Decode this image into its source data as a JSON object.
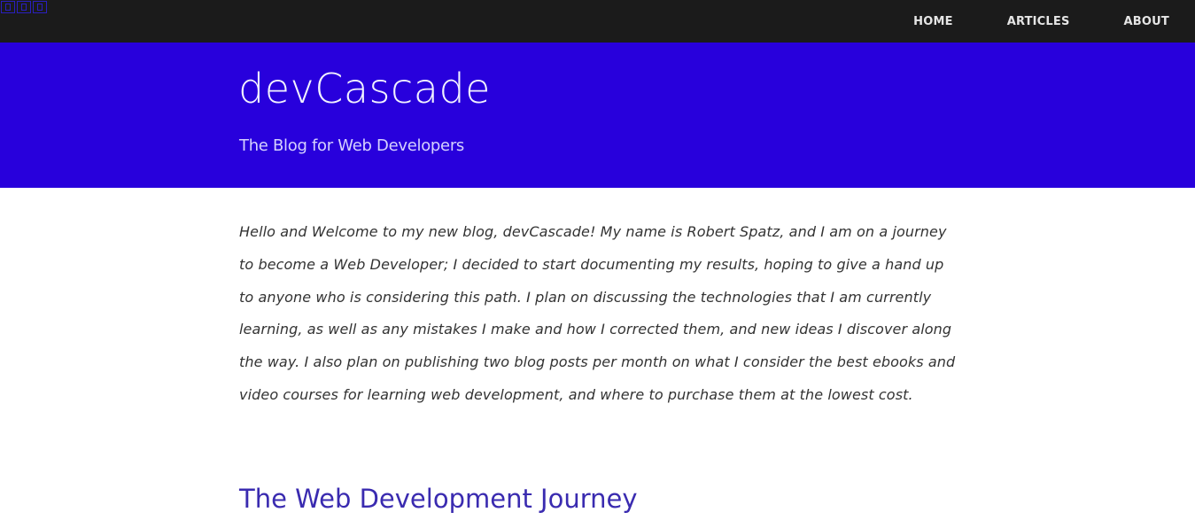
{
  "social_icons": [
    "square-icon",
    "square-icon",
    "square-icon"
  ],
  "nav": {
    "items": [
      {
        "label": "HOME"
      },
      {
        "label": "ARTICLES"
      },
      {
        "label": "ABOUT"
      }
    ]
  },
  "header": {
    "title": "devCascade",
    "subtitle": "The Blog for Web Developers"
  },
  "main": {
    "intro": "Hello and Welcome to my new blog, devCascade! My name is Robert Spatz, and I am on a journey to become a Web Developer; I decided to start documenting my results, hoping to give a hand up to anyone who is considering this path. I plan on discussing the technologies that I am currently learning, as well as any mistakes I make and how I corrected them, and new ideas I discover along the way. I also plan on publishing two blog posts per month on what I consider the best ebooks and video courses for learning web development, and where to purchase them at the lowest cost.",
    "section_heading": "The Web Development Journey"
  },
  "colors": {
    "topbar": "#1b1b1b",
    "hero": "#2800dc",
    "heading_accent": "#3a2bb0",
    "body_text": "#333333"
  }
}
